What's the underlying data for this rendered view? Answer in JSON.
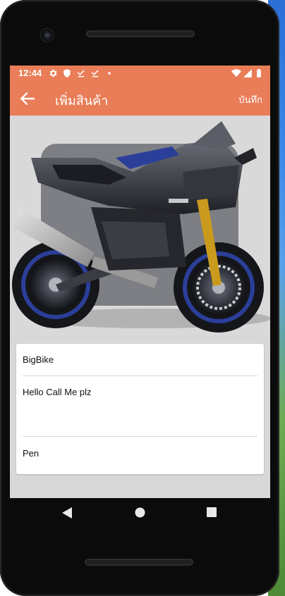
{
  "status_bar": {
    "time": "12:44",
    "left_icons": [
      "settings-icon",
      "shield-icon",
      "download-done-icon",
      "download-done-icon",
      "dot-icon"
    ],
    "right_icons": [
      "wifi-icon",
      "signal-icon",
      "battery-icon"
    ]
  },
  "app_bar": {
    "title": "เพิ่มสินค้า",
    "save_label": "บันทึก",
    "color": "#e97d58"
  },
  "product_image": {
    "subject": "sport-motorcycle-image",
    "colors": {
      "body": "#2c2d33",
      "accent": "#2b3f9a",
      "fork": "#c99a1e"
    }
  },
  "form": {
    "name_value": "BigBike",
    "description_value": "Hello Call Me plz",
    "extra_value": "Pen"
  },
  "nav_bar": {
    "buttons": [
      "back-triangle-icon",
      "home-circle-icon",
      "recents-square-icon"
    ]
  }
}
